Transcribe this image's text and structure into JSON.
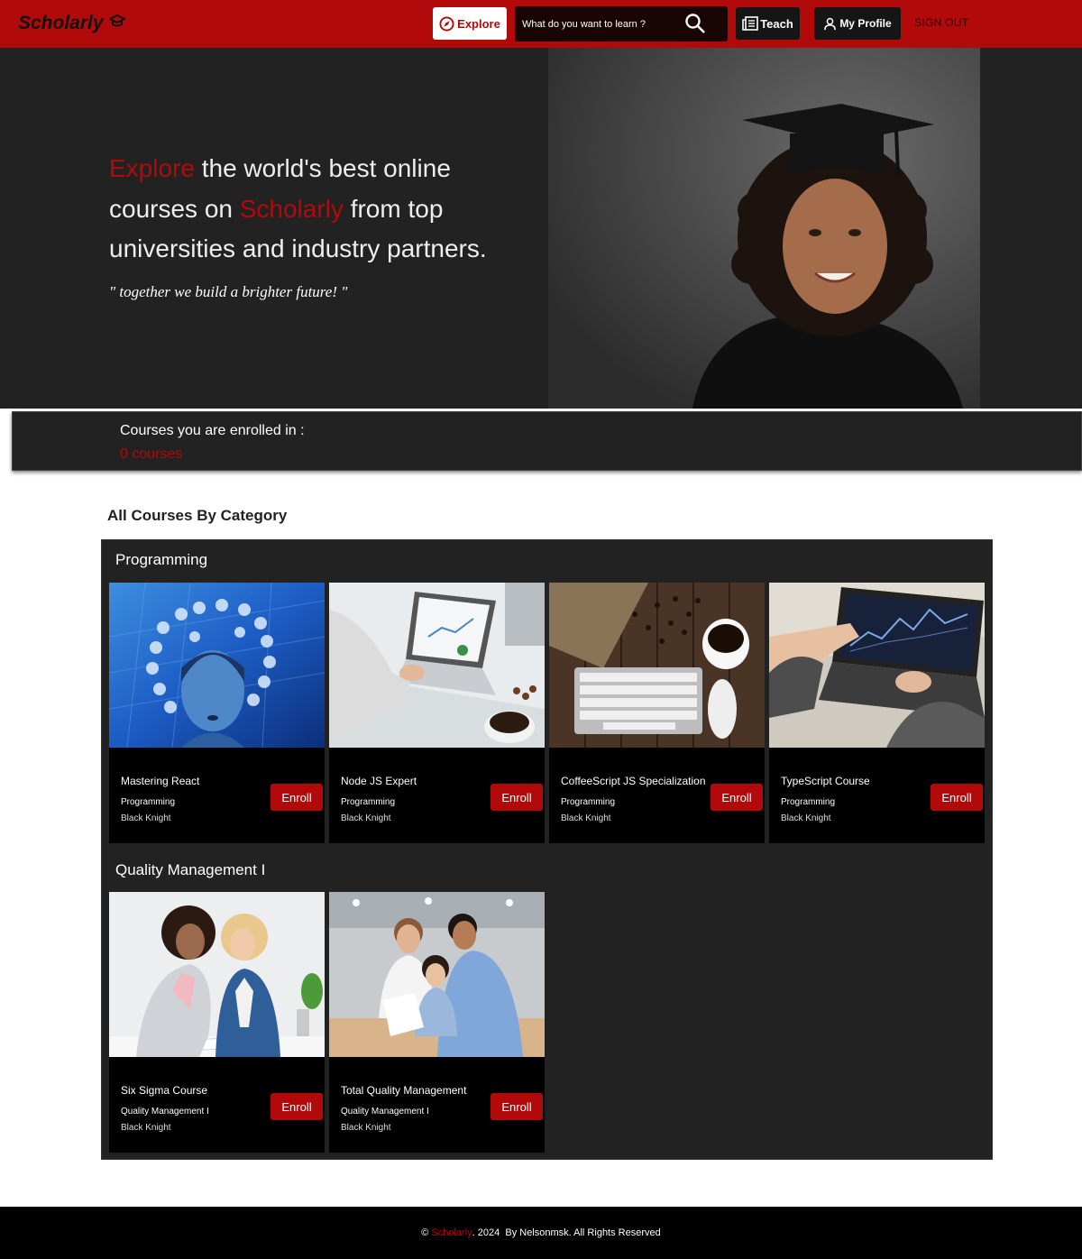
{
  "header": {
    "brand": "Scholarly",
    "explore_label": "Explore",
    "search_placeholder": "What do you want to learn ?",
    "teach_label": "Teach",
    "profile_label": "My Profile",
    "signout_label": "SIGN OUT"
  },
  "hero": {
    "word1": "Explore",
    "text1": " the world's best online courses on ",
    "word2": "Scholarly",
    "text2": " from top universities and industry partners.",
    "quote": "\" together we build a brighter future! \""
  },
  "enrolled": {
    "label": "Courses you are enrolled in :",
    "count": "0 courses"
  },
  "catalog": {
    "title": "All Courses By Category",
    "categories": [
      {
        "name": "Programming",
        "courses": [
          {
            "name": "Mastering React",
            "category": "Programming",
            "author": "Black Knight",
            "button": "Enroll",
            "image": "ai-face-network"
          },
          {
            "name": "Node JS Expert",
            "category": "Programming",
            "author": "Black Knight",
            "button": "Enroll",
            "image": "laptop-desk"
          },
          {
            "name": "CoffeeScript JS Specialization",
            "category": "Programming",
            "author": "Black Knight",
            "button": "Enroll",
            "image": "keyboard-coffee"
          },
          {
            "name": "TypeScript Course",
            "category": "Programming",
            "author": "Black Knight",
            "button": "Enroll",
            "image": "laptop-chart"
          }
        ]
      },
      {
        "name": "Quality Management I",
        "courses": [
          {
            "name": "Six Sigma Course",
            "category": "Quality Management I",
            "author": "Black Knight",
            "button": "Enroll",
            "image": "two-women-desk"
          },
          {
            "name": "Total Quality Management",
            "category": "Quality Management I",
            "author": "Black Knight",
            "button": "Enroll",
            "image": "team-meeting"
          }
        ]
      }
    ]
  },
  "footer": {
    "copyright": "©",
    "brand": "Scholarly",
    "rest": ". 2024  By Nelsonmsk. All Rights Reserved"
  },
  "colors": {
    "accent": "#b20a0a",
    "dark": "#222222",
    "card": "#000000"
  }
}
